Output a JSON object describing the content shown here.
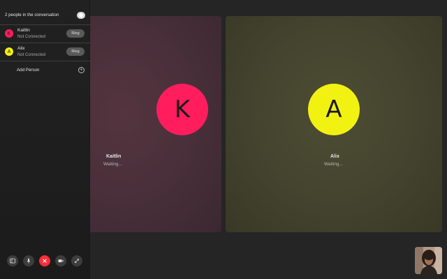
{
  "sidebar": {
    "title": "2 people in the conversation",
    "people": [
      {
        "initial": "K",
        "name": "Kaitlin",
        "status": "Not Connected",
        "action": "Ring",
        "color": "#ff1d5e"
      },
      {
        "initial": "A",
        "name": "Alix",
        "status": "Not Connected",
        "action": "Ring",
        "color": "#f2f212"
      }
    ],
    "add_person_label": "Add Person"
  },
  "tiles": [
    {
      "initial": "K",
      "name": "Kaitlin",
      "status": "Waiting...",
      "color": "#ff1d5e"
    },
    {
      "initial": "A",
      "name": "Alix",
      "status": "Waiting...",
      "color": "#f2f212"
    }
  ],
  "controls": [
    {
      "icon": "sidebar-toggle-icon"
    },
    {
      "icon": "microphone-icon"
    },
    {
      "icon": "end-call-icon",
      "color": "#ff2d3a"
    },
    {
      "icon": "video-camera-icon"
    },
    {
      "icon": "fullscreen-icon"
    }
  ],
  "self_view": {
    "icon": "self-camera-preview"
  }
}
